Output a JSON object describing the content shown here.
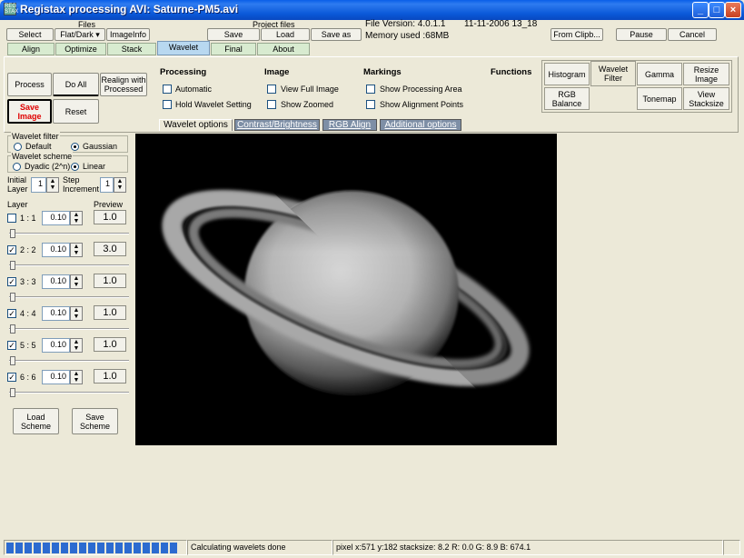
{
  "window": {
    "title": "Registax processing AVI: Saturne-PM5.avi",
    "app_icon_text": "REG STAX"
  },
  "header": {
    "files_label": "Files",
    "project_files_label": "Project files",
    "file_version": "File Version: 4.0.1.1",
    "date": "11-11-2006 13_18",
    "memory_used": "Memory used :68MB"
  },
  "toolbar": {
    "select": "Select",
    "flat_dark": "Flat/Dark ▾",
    "imageinfo": "ImageInfo",
    "save": "Save",
    "load": "Load",
    "save_as": "Save as",
    "from_clipboard": "From Clipb...",
    "pause": "Pause",
    "cancel": "Cancel"
  },
  "tabs": [
    {
      "label": "Align"
    },
    {
      "label": "Optimize"
    },
    {
      "label": "Stack"
    },
    {
      "label": "Wavelet",
      "active": true
    },
    {
      "label": "Final"
    },
    {
      "label": "About"
    }
  ],
  "actions": {
    "process": "Process",
    "do_all": "Do All",
    "realign": "Realign with Processed",
    "save_image": "Save Image",
    "reset": "Reset"
  },
  "processing": {
    "title": "Processing",
    "automatic": "Automatic",
    "hold_wavelet": "Hold Wavelet Setting"
  },
  "image_group": {
    "title": "Image",
    "view_full": "View Full Image",
    "show_zoomed": "Show Zoomed"
  },
  "markings": {
    "title": "Markings",
    "show_area": "Show Processing Area",
    "show_alignment": "Show Alignment Points"
  },
  "functions": {
    "title": "Functions",
    "histogram": "Histogram",
    "wavelet_filter": "Wavelet Filter",
    "gamma": "Gamma",
    "resize_image": "Resize Image",
    "rgb_balance": "RGB Balance",
    "tonemap": "Tonemap",
    "view_stacksize": "View Stacksize"
  },
  "subtabs": [
    {
      "label": "Wavelet options",
      "active": true
    },
    {
      "label": "Contrast/Brightness"
    },
    {
      "label": "RGB Align"
    },
    {
      "label": "Additional options"
    }
  ],
  "wavelet_filter": {
    "title": "Wavelet filter",
    "default": "Default",
    "gaussian": "Gaussian",
    "selected": "Gaussian"
  },
  "wavelet_scheme": {
    "title": "Wavelet scheme",
    "dyadic": "Dyadic (2^n)",
    "linear": "Linear",
    "selected": "Linear"
  },
  "initial_layer": {
    "label1": "Initial",
    "label2": "Layer",
    "value": "1"
  },
  "step_increment": {
    "label1": "Step",
    "label2": "Increment",
    "value": "1"
  },
  "layers_header": {
    "layer": "Layer",
    "preview": "Preview"
  },
  "layers": [
    {
      "label": "1 : 1",
      "checked": false,
      "value": "0.10",
      "preview": "1.0"
    },
    {
      "label": "2 : 2",
      "checked": true,
      "value": "0.10",
      "preview": "3.0"
    },
    {
      "label": "3 : 3",
      "checked": true,
      "value": "0.10",
      "preview": "1.0"
    },
    {
      "label": "4 : 4",
      "checked": true,
      "value": "0.10",
      "preview": "1.0"
    },
    {
      "label": "5 : 5",
      "checked": true,
      "value": "0.10",
      "preview": "1.0"
    },
    {
      "label": "6 : 6",
      "checked": true,
      "value": "0.10",
      "preview": "1.0"
    }
  ],
  "scheme_buttons": {
    "load": "Load Scheme",
    "save": "Save Scheme"
  },
  "status": {
    "message": "Calculating wavelets done",
    "pixel_info": "pixel x:571 y:182 stacksize: 8.2 R: 0.0 G: 8.9 B: 674.1",
    "progress_segments": 19
  },
  "colors": {
    "accent": "#0A58D8",
    "save_image_red": "#E00000",
    "tab_active": "#B8D8F0",
    "tab": "#D8EBD0"
  }
}
